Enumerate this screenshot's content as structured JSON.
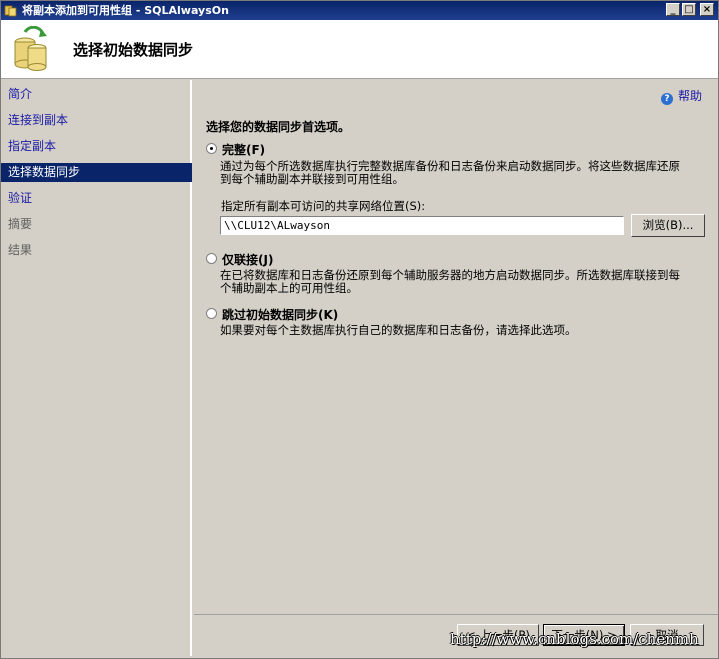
{
  "window": {
    "title": "将副本添加到可用性组 - SQLAlwaysOn"
  },
  "header": {
    "title": "选择初始数据同步"
  },
  "sidebar": {
    "items": [
      {
        "label": "简介",
        "state": "link"
      },
      {
        "label": "连接到副本",
        "state": "link"
      },
      {
        "label": "指定副本",
        "state": "link"
      },
      {
        "label": "选择数据同步",
        "state": "active"
      },
      {
        "label": "验证",
        "state": "link"
      },
      {
        "label": "摘要",
        "state": "disabled"
      },
      {
        "label": "结果",
        "state": "disabled"
      }
    ]
  },
  "help": {
    "label": "帮助",
    "icon": "help-icon"
  },
  "main": {
    "heading": "选择您的数据同步首选项。",
    "options": [
      {
        "label": "完整(F)",
        "checked": true,
        "description_line1": "通过为每个所选数据库执行完整数据库备份和日志备份来启动数据同步。将这些数据库还原",
        "description_line2": "到每个辅助副本并联接到可用性组。"
      },
      {
        "label": "仅联接(J)",
        "checked": false,
        "description_line1": "在已将数据库和日志备份还原到每个辅助服务器的地方启动数据同步。所选数据库联接到每",
        "description_line2": "个辅助副本上的可用性组。"
      },
      {
        "label": "跳过初始数据同步(K)",
        "checked": false,
        "description_line1": "如果要对每个主数据库执行自己的数据库和日志备份，请选择此选项。",
        "description_line2": ""
      }
    ],
    "share_label": "指定所有副本可访问的共享网络位置(S):",
    "share_value": "\\\\CLU12\\ALwayson",
    "browse_label": "浏览(B)..."
  },
  "footer": {
    "prev_label": "< 上一步(P)",
    "next_label": "下一步(N) >",
    "cancel_label": "取消"
  },
  "watermark": "http://www.cnblogs.com/chenmh",
  "colors": {
    "title_bar": "#0a246a",
    "link": "#1a1aa6",
    "selected": "#0a246a",
    "panel": "#d4d0c8"
  }
}
